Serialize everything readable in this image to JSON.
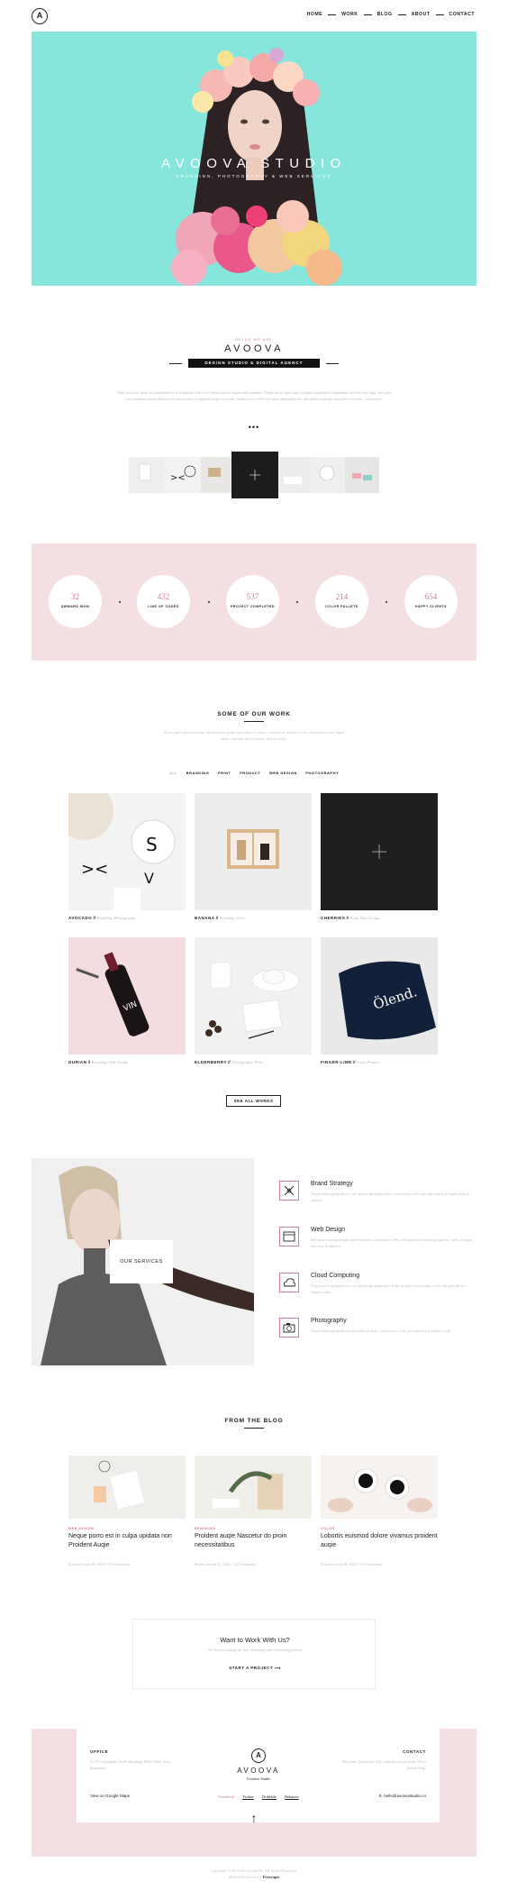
{
  "header": {
    "logo_letter": "A",
    "nav": [
      "HOME",
      "WORK",
      "BLOG",
      "ABOUT",
      "CONTACT"
    ]
  },
  "hero": {
    "title": "AVOOVA STUDIO",
    "subtitle": "BRANDING, PHOTOGRAPHY & WEB SERVICES",
    "bg_color": "#86e6dc"
  },
  "about": {
    "hello": "HELLO WE ARE",
    "brand": "AVOOVA",
    "tagline": "DESIGN STUDIO & DIGITAL AGENCY",
    "intro": "Nam sed nunc dolor in reprehenderit in voluptate velit esse cillum dolore fugiat nulla pariatur. Neque porro quisi quia voluptas asperiatut voluptatem sed velit sed fugit, sed quia consequuntur magni dolores eos qui ratione voluptatem sequi nesciunt. Neque porro velit esse porro quisquam est, qui dolorem ipsum quia dolor sit amet, consectetur.",
    "dots": "•••"
  },
  "stats": [
    {
      "num": "32",
      "label": "AWWARD WON"
    },
    {
      "num": "432",
      "label": "LINE OF CODES"
    },
    {
      "num": "537",
      "label": "PROJECT COMPLETED"
    },
    {
      "num": "214",
      "label": "COLOR PALLETE"
    },
    {
      "num": "654",
      "label": "HAPPY CLIENTS"
    }
  ],
  "work": {
    "title": "SOME OF OUR WORK",
    "desc": "Neque porro quisquam est, qui dolorem ipsum quia dolor sit amet, consectetur, adipisci velit, sed quia fores ex fugiat nulla cupidatat non proident, sunt in culpa.",
    "filters": [
      "ALL",
      "BRANDING",
      "PRINT",
      "PRODUCT",
      "WEB DESIGN",
      "PHOTOGRAPHY"
    ],
    "items": [
      {
        "name": "AVOCADO",
        "tags": "Branding, Photography"
      },
      {
        "name": "BANANA",
        "tags": "Branding, Print"
      },
      {
        "name": "CHERRIES",
        "tags": "Print, Web Design"
      },
      {
        "name": "DURIAN",
        "tags": "Branding, Web Design"
      },
      {
        "name": "ELDERBERRY",
        "tags": "Photography, Print"
      },
      {
        "name": "FINGER-LIME",
        "tags": "Print, Product"
      }
    ],
    "sep": "//",
    "see_all": "SEE ALL WORKS",
    "bottle_text": "VIN",
    "tee_text": "Ölend."
  },
  "services": {
    "box": "OUR SERVICES",
    "items": [
      {
        "title": "Brand Strategy",
        "icon": "pen-tool-icon",
        "desc": "Neque porro quisquam est, qui ipsum quisquam amet, consectetur, velit, sed quia non in sisi quia amet in adipisci."
      },
      {
        "title": "Web Design",
        "icon": "browser-window-icon",
        "desc": "Sed ipsum quisquam quia dolor sit amet, consectetur, velit, sed quia non in rhoncus quia est, velit, sed quia non vero in adipisci."
      },
      {
        "title": "Cloud Computing",
        "icon": "cloud-icon",
        "desc": "Neque porro quisquam est, qui ipsum quisquam quia dolor sit amet, consectetur, velit, sed quia non in adipisci velit."
      },
      {
        "title": "Photography",
        "icon": "camera-icon",
        "desc": "Neque porro quisquam est qui dolor sit amet, consectetur, velit, sed quia non in adipisci velit."
      }
    ]
  },
  "blog": {
    "title": "FROM THE BLOG",
    "posts": [
      {
        "cat": "WEB DESIGN",
        "title": "Neque porro est in culpa upidata non Proident Auqie",
        "meta": "Posted on Jun 18, 2014 // 14 Comments"
      },
      {
        "cat": "BRANDING",
        "title": "Proident auqie Nascetur do proin necessitatibus",
        "meta": "Posted on Jun 11, 2014 // 14 Comments"
      },
      {
        "cat": "COLOR",
        "title": "Lobortis euismod dolore vivamus proident auqie",
        "meta": "Posted on Jun 28, 2014 // 14 Comments"
      }
    ]
  },
  "cta": {
    "title": "Want to Work With Us?",
    "desc": "We always looking for new challenges and interesting projects",
    "button": "START A PROJECT",
    "arrow": "⟶"
  },
  "footer": {
    "office_title": "OFFICE",
    "office_addr": "Jl.176 Cikampahr Street Bandung 40615 West Java, Indonesia",
    "map_link": "View on Google Maps",
    "logo_letter": "A",
    "brand": "AVOOVA",
    "brand_sub": "Creative Studio",
    "social": [
      "Facebook",
      "Twitter",
      "Dribbble",
      "Behance"
    ],
    "contact_title": "CONTACT",
    "contact_desc": "Have any Questions? Let's talk about you work. We're here to help.",
    "email": "E. hello@avoovastudio.co",
    "up_arrow": "↑"
  },
  "copyright": {
    "line1": "Copyright © 2014 Avoova Studio. All Rights Reserved.",
    "line2": "Made With Stroke by",
    "author": "Freewapic"
  },
  "colors": {
    "accent": "#d77b8e",
    "pink_bg": "#f4e0e2",
    "mint": "#86e6dc"
  }
}
